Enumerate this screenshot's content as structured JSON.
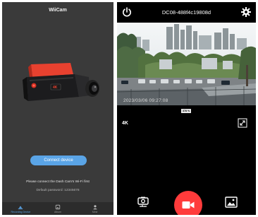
{
  "left_app": {
    "title": "WiiCam",
    "connect_button": "Connect device",
    "hint": "Please connect the Dash Cam's Wi-Fi first",
    "default_password": "Default password: 12345678",
    "nav": [
      {
        "label": "Recording Device",
        "icon": "device-icon",
        "active": true
      },
      {
        "label": "Album",
        "icon": "album-icon",
        "active": false
      },
      {
        "label": "Mine",
        "icon": "person-icon",
        "active": false
      }
    ],
    "accent_color": "#5aa4e6"
  },
  "right_app": {
    "device_id": "DC08-488f4c19808d",
    "timestamp": "2023/03/06  09:27:08",
    "battery_percent": "378 %",
    "resolution": "4K",
    "icons": {
      "power": "power-icon",
      "settings": "gear-icon",
      "fullscreen": "fullscreen-icon",
      "flip": "camera-flip-icon",
      "record": "video-record-icon",
      "gallery": "gallery-icon"
    },
    "record_color": "#ff3b3b"
  }
}
